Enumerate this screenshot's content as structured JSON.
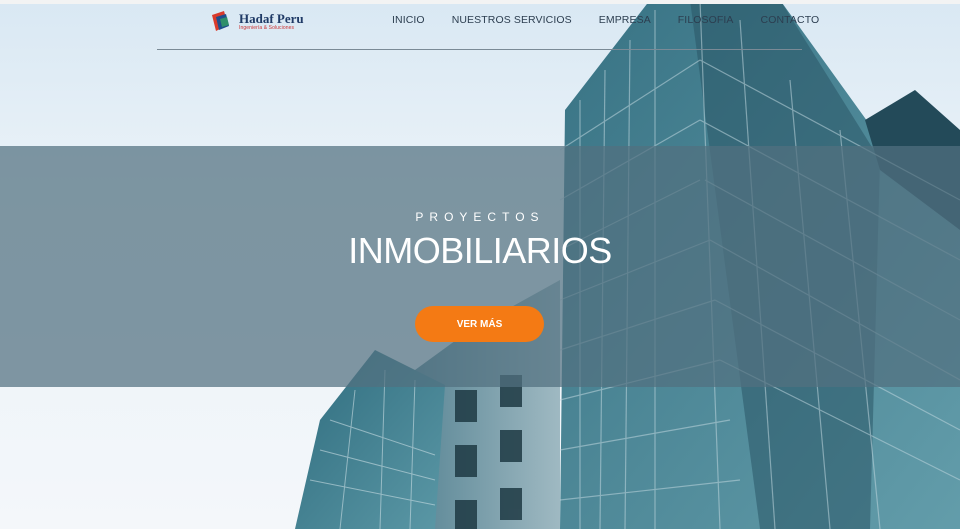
{
  "brand": {
    "name": "Hadaf Peru",
    "tagline": "Ingeniería & Soluciones"
  },
  "nav": {
    "items": [
      {
        "label": "INICIO"
      },
      {
        "label": "NUESTROS SERVICIOS"
      },
      {
        "label": "EMPRESA"
      },
      {
        "label": "FILOSOFIA"
      },
      {
        "label": "CONTACTO"
      }
    ]
  },
  "hero": {
    "subtitle": "PROYECTOS",
    "title": "INMOBILIARIOS",
    "cta_label": "VER MÁS"
  },
  "colors": {
    "accent": "#f47a14",
    "banner_overlay": "#527080",
    "nav_text": "#2c3e50",
    "building_glass": "#3d7f8f"
  }
}
